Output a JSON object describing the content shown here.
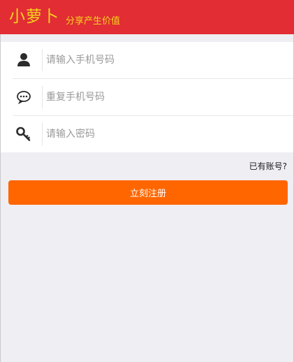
{
  "header": {
    "brand": "小萝卜",
    "slogan": "分享产生价值"
  },
  "form": {
    "phone": {
      "icon": "user-icon",
      "placeholder": "请输入手机号码",
      "value": ""
    },
    "repeat_phone": {
      "icon": "chat-bubble-icon",
      "placeholder": "重复手机号码",
      "value": ""
    },
    "password": {
      "icon": "key-icon",
      "placeholder": "请输入密码",
      "value": ""
    }
  },
  "links": {
    "have_account": "已有账号?"
  },
  "actions": {
    "register_label": "立刻注册"
  },
  "colors": {
    "header_bg": "#e12d33",
    "brand_text": "#f7d21f",
    "button_bg": "#ff6600",
    "page_bg": "#efeef3"
  }
}
